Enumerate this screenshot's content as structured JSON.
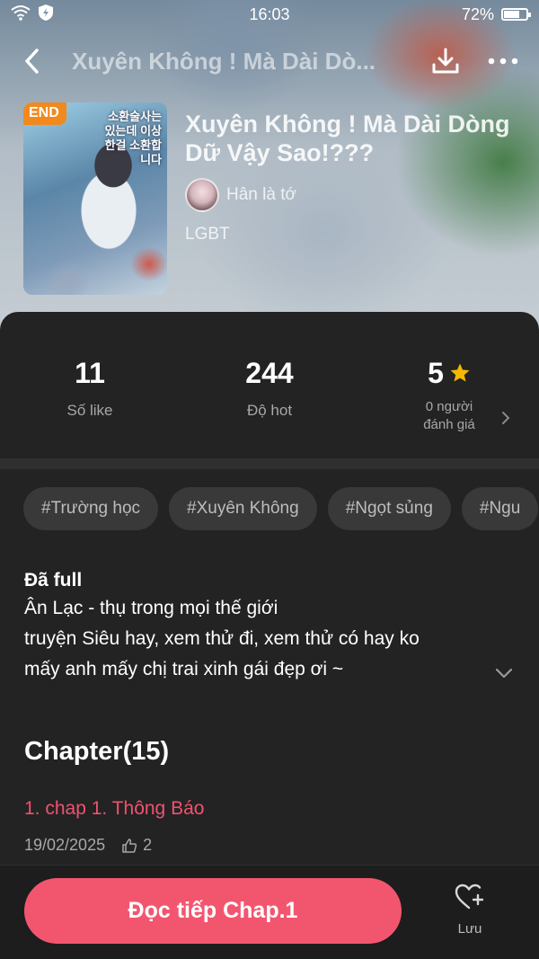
{
  "status_bar": {
    "time": "16:03",
    "battery": "72%",
    "battery_level": 0.72
  },
  "nav": {
    "title": "Xuyên Không ! Mà Dài Dò..."
  },
  "book": {
    "cover_badge": "END",
    "cover_text": "소환술사는 있는데 이상한걸 소환합니다",
    "title": "Xuyên Không ! Mà Dài Dòng Dữ Vậy Sao!???",
    "author": "Hân là tớ",
    "genre": "LGBT"
  },
  "stats": {
    "likes_value": "11",
    "likes_label": "Số like",
    "hot_value": "244",
    "hot_label": "Độ hot",
    "rating_value": "5",
    "rating_label_1": "0 người",
    "rating_label_2": "đánh giá"
  },
  "tags": [
    "#Trường học",
    "#Xuyên Không",
    "#Ngọt sủng",
    "#Ngu"
  ],
  "description": {
    "status": "Đã full",
    "lines": [
      "Ân Lạc - thụ  trong mọi thế giới",
      "truyện Siêu hay,  xem thử đi, xem thử có hay ko",
      "mấy anh mấy chị trai xinh gái đẹp ơi ~"
    ]
  },
  "chapters": {
    "heading": "Chapter(15)",
    "items": [
      {
        "title": "1. chap 1. Thông Báo",
        "date": "19/02/2025",
        "likes": "2"
      }
    ]
  },
  "actions": {
    "read_label": "Đọc tiếp Chap.1",
    "save_label": "Lưu"
  },
  "colors": {
    "accent": "#f2566f",
    "chapter_title": "#f0526f",
    "star": "#f5b800",
    "badge": "#f08a1e"
  }
}
